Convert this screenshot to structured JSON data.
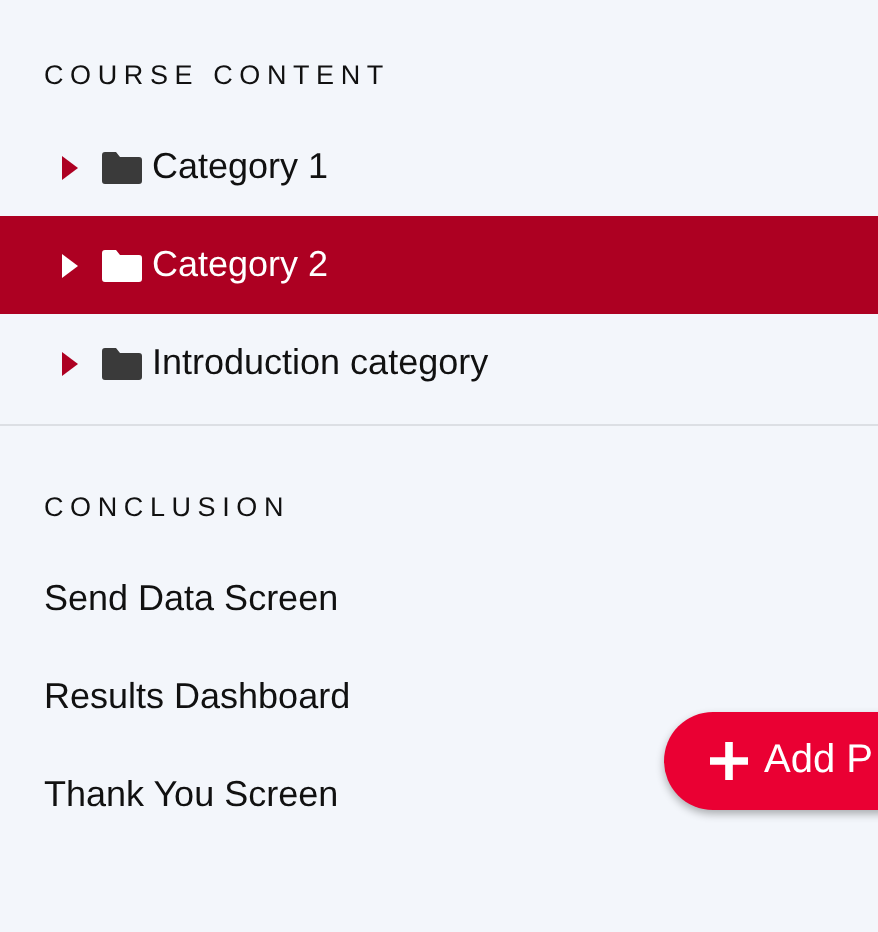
{
  "sections": [
    {
      "heading": "COURSE CONTENT",
      "kind": "tree",
      "items": [
        {
          "label": "Category 1",
          "selected": false,
          "expanded": false
        },
        {
          "label": "Category 2",
          "selected": true,
          "expanded": false
        },
        {
          "label": "Introduction category",
          "selected": false,
          "expanded": false
        }
      ]
    },
    {
      "heading": "CONCLUSION",
      "kind": "list",
      "items": [
        {
          "label": "Send Data Screen"
        },
        {
          "label": "Results Dashboard"
        },
        {
          "label": "Thank You Screen"
        }
      ]
    }
  ],
  "add_button": {
    "label": "Add P"
  }
}
